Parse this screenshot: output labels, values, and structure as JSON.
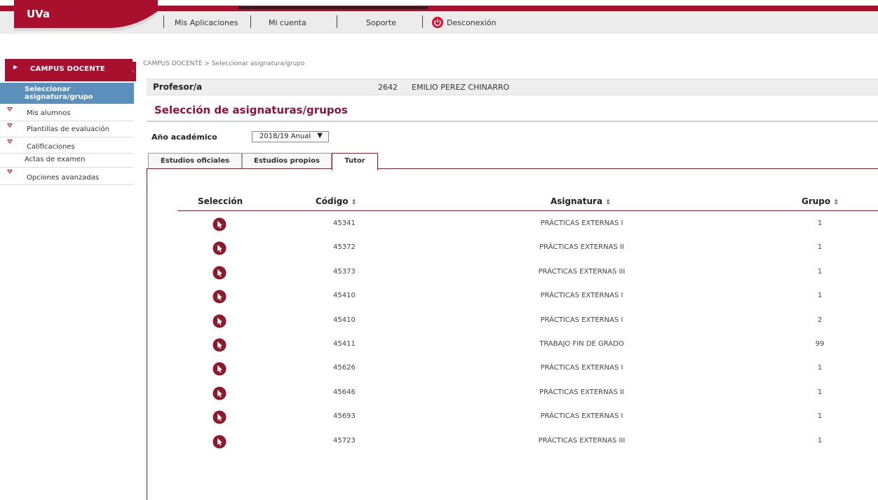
{
  "header": {
    "logo": "UVa",
    "menu": [
      {
        "label": "Mis Aplicaciones"
      },
      {
        "label": "Mi cuenta"
      },
      {
        "label": "Soporte"
      },
      {
        "label": "Desconexión"
      }
    ]
  },
  "sidebar": {
    "title": "CAMPUS DOCENTE",
    "active_item": "Seleccionar asignatura/grupo",
    "items": [
      {
        "label": "Mis alumnos"
      },
      {
        "label": "Plantillas de evaluación"
      },
      {
        "label": "Calificaciones"
      },
      {
        "label": "Actas de examen"
      },
      {
        "label": "Opciones avanzadas"
      }
    ]
  },
  "breadcrumb": "CAMPUS DOCENTE > Seleccionar asignatura/grupo",
  "profesor": {
    "label": "Profesor/a",
    "code": "2642",
    "name": "EMILIO PEREZ CHINARRO"
  },
  "page_title": "Selección de asignaturas/grupos",
  "academic_year": {
    "label": "Año académico",
    "value": "2018/19 Anual"
  },
  "tabs": [
    {
      "label": "Estudios oficiales"
    },
    {
      "label": "Estudios propios"
    },
    {
      "label": "Tutor"
    }
  ],
  "table": {
    "headers": {
      "select": "Selección",
      "code": "Código",
      "subject": "Asignatura",
      "group": "Grupo"
    },
    "sort_glyph": "⇕",
    "rows": [
      {
        "code": "45341",
        "subject": "PRÁCTICAS EXTERNAS I",
        "group": "1"
      },
      {
        "code": "45372",
        "subject": "PRÁCTICAS EXTERNAS II",
        "group": "1"
      },
      {
        "code": "45373",
        "subject": "PRÁCTICAS EXTERNAS III",
        "group": "1"
      },
      {
        "code": "45410",
        "subject": "PRÁCTICAS EXTERNAS I",
        "group": "1"
      },
      {
        "code": "45410",
        "subject": "PRÁCTICAS EXTERNAS I",
        "group": "2"
      },
      {
        "code": "45411",
        "subject": "TRABAJO FIN DE GRADO",
        "group": "99"
      },
      {
        "code": "45626",
        "subject": "PRÁCTICAS EXTERNAS I",
        "group": "1"
      },
      {
        "code": "45646",
        "subject": "PRÁCTICAS EXTERNAS II",
        "group": "1"
      },
      {
        "code": "45693",
        "subject": "PRÁCTICAS EXTERNAS I",
        "group": "1"
      },
      {
        "code": "45723",
        "subject": "PRÁCTICAS EXTERNAS III",
        "group": "1"
      }
    ]
  },
  "colors": {
    "brand": "#a8102e",
    "title": "#8b1538",
    "active_side": "#5b8fbc",
    "select_icon": "#8b1a2c"
  },
  "icons": {
    "select": "cursor-select-icon",
    "logout": "power-icon",
    "sort": "sort-icon"
  }
}
